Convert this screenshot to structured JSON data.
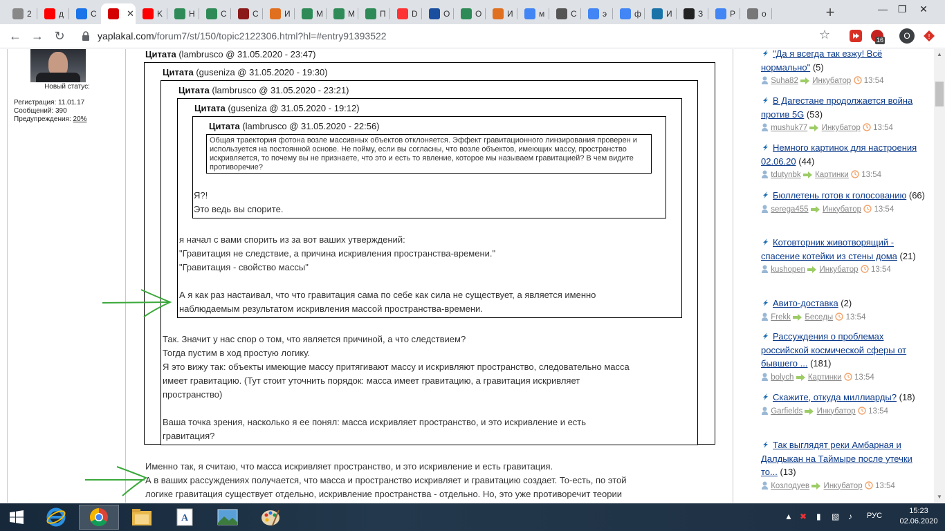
{
  "browser": {
    "tabs": [
      {
        "label": "2",
        "icon": "gear-icon",
        "color": "#888888"
      },
      {
        "label": "д",
        "icon": "youtube-icon",
        "color": "#ff0000"
      },
      {
        "label": "C",
        "icon": "shield-icon",
        "color": "#1a73e8"
      },
      {
        "label": "",
        "icon": "yaplakal-icon",
        "color": "#d40000",
        "active": true
      },
      {
        "label": "K",
        "icon": "youtube-icon",
        "color": "#ff0000"
      },
      {
        "label": "H",
        "icon": "asterisk-icon",
        "color": "#2e8b57"
      },
      {
        "label": "C",
        "icon": "asterisk-icon",
        "color": "#2e8b57"
      },
      {
        "label": "C",
        "icon": "m-icon",
        "color": "#8b1a1a"
      },
      {
        "label": "И",
        "icon": "flag-icon",
        "color": "#e07020"
      },
      {
        "label": "M",
        "icon": "asterisk-icon",
        "color": "#2e8b57"
      },
      {
        "label": "M",
        "icon": "asterisk-icon",
        "color": "#2e8b57"
      },
      {
        "label": "П",
        "icon": "asterisk-icon",
        "color": "#2e8b57"
      },
      {
        "label": "D",
        "icon": "d-icon",
        "color": "#ff3333"
      },
      {
        "label": "O",
        "icon": "yaf-icon",
        "color": "#1a4fa0"
      },
      {
        "label": "O",
        "icon": "asterisk-icon",
        "color": "#2e8b57"
      },
      {
        "label": "И",
        "icon": "flag-icon",
        "color": "#e07020"
      },
      {
        "label": "м",
        "icon": "google-icon",
        "color": "#4285f4"
      },
      {
        "label": "C",
        "icon": "chart-icon",
        "color": "#555555"
      },
      {
        "label": "э",
        "icon": "google-icon",
        "color": "#4285f4"
      },
      {
        "label": "ф",
        "icon": "google-icon",
        "color": "#4285f4"
      },
      {
        "label": "И",
        "icon": "ds-icon",
        "color": "#1a73a8"
      },
      {
        "label": "З",
        "icon": "wikipedia-icon",
        "color": "#222222"
      },
      {
        "label": "P",
        "icon": "google-icon",
        "color": "#4285f4"
      },
      {
        "label": "o",
        "icon": "globe-icon",
        "color": "#777777"
      }
    ],
    "url_host": "yaplakal.com",
    "url_path": "/forum7/st/150/topic2122306.html?hl=#entry91393522",
    "ext_badge": "16",
    "profile_letter": "O"
  },
  "user": {
    "status_label": "Новый статус:",
    "registration": "Регистрация: 11.01.17",
    "messages": "Сообщений: 390",
    "warnings_label": "Предупреждения: ",
    "warnings_value": "20%"
  },
  "post": {
    "q1_head_label": "Цитата",
    "q1_head_meta": "(lambrusco @ 31.05.2020 - 23:47)",
    "q2_head_label": "Цитата",
    "q2_head_meta": "(guseniza @ 31.05.2020 - 19:30)",
    "q3_head_label": "Цитата",
    "q3_head_meta": "(lambrusco @ 31.05.2020 - 23:21)",
    "q4_head_label": "Цитата",
    "q4_head_meta": "(guseniza @ 31.05.2020 - 19:12)",
    "q5_head_label": "Цитата",
    "q5_head_meta": "(lambrusco @ 31.05.2020 - 22:56)",
    "q5_text": "Общая траектория фотона возле массивных объектов отклоняется. Эффект гравитационного линзирования проверен и используется  на постоянной основе. Не пойму, если вы согласны, что возле объектов, имеющих массу, пространство искривляется, то почему вы не признаете, что это и есть то явление, которое мы называем гравитацией? В чем видите противоречие?",
    "q4_text_1": "Я?!",
    "q4_text_2": "Это ведь вы спорите.",
    "q3_text_1": "я начал с вами спорить из за вот ваших утверждений:",
    "q3_text_2": "\"Гравитация не следствие, а причина искривления пространства-времени.\"",
    "q3_text_3": "\"Гравитация - свойство массы\"",
    "q3_text_4": "А я как раз настаивал, что что гравитация сама по себе как сила не существует, а является именно",
    "q3_text_5": "наблюдаемым результатом искривления массой пространства-времени.",
    "q2_text_1": "Так. Значит у нас спор о том, что является причиной, а что следствием?",
    "q2_text_2": "Тогда пустим в ход простую логику.",
    "q2_text_3": "Я это вижу так: объекты имеющие массу притягивают массу и искривляют пространство, следовательно масса",
    "q2_text_4": "имеет гравитацию. (Тут стоит уточнить порядок: масса имеет гравитацию, а гравитация искривляет",
    "q2_text_5": "пространство)",
    "q2_text_6": "Ваша точка зрения, насколько я ее понял: масса искривляет пространство, и это искривление и есть",
    "q2_text_7": "гравитация?",
    "body_1": "Именно так, я считаю, что масса искривляет пространство, и это искривление и есть гравитация.",
    "body_2": "А в ваших рассуждениях получается, что масса и пространство искривляет и гравитацию создает. То-есть, по этой",
    "body_3": "логике гравитация существует отдельно, искривление пространства - отдельно. Но, это уже противоречит теории"
  },
  "sidebar": {
    "topics": [
      {
        "title": "\"Да я всегда так езжу! Всё нормально\"",
        "count": "(5)",
        "user": "Suha82",
        "section": "Инкубатор",
        "time": "13:54"
      },
      {
        "title": "В Дагестане продолжается война против 5G",
        "count": "(53)",
        "user": "mushuk77",
        "section": "Инкубатор",
        "time": "13:54"
      },
      {
        "title": "Немного картинок для настроения 02.06.20",
        "count": "(44)",
        "user": "tdutynbk",
        "section": "Картинки",
        "time": "13:54"
      },
      {
        "title": "Бюллетень готов к голосованию",
        "count": "(66)",
        "user": "serega455",
        "section": "Инкубатор",
        "time": "13:54"
      },
      {
        "title": "Котовторник животворящий - спасение котейки из стены дома",
        "count": "(21)",
        "user": "kushopen",
        "section": "Инкубатор",
        "time": "13:54"
      },
      {
        "title": "Авито-доставка",
        "count": "(2)",
        "user": "Frekk",
        "section": "Беседы",
        "time": "13:54"
      },
      {
        "title": "Рассуждения о проблемах российской космической сферы от бывшего ...",
        "count": "(181)",
        "user": "bolych",
        "section": "Картинки",
        "time": "13:54"
      },
      {
        "title": "Скажите, откуда миллиарды?",
        "count": "(18)",
        "user": "Garfields",
        "section": "Инкубатор",
        "time": "13:54"
      },
      {
        "title": "Так выглядят реки Амбарная и Далдыкан на Таймыре после утечки то...",
        "count": "(13)",
        "user": "Козлодуев",
        "section": "Инкубатор",
        "time": "13:54"
      }
    ]
  },
  "taskbar": {
    "lang": "РУС",
    "time": "15:23",
    "date": "02.06.2020"
  },
  "colors": {
    "link": "#0b3a8c",
    "arrow_green": "#3aa83a",
    "topic_arrow": "#1e6fb5"
  }
}
